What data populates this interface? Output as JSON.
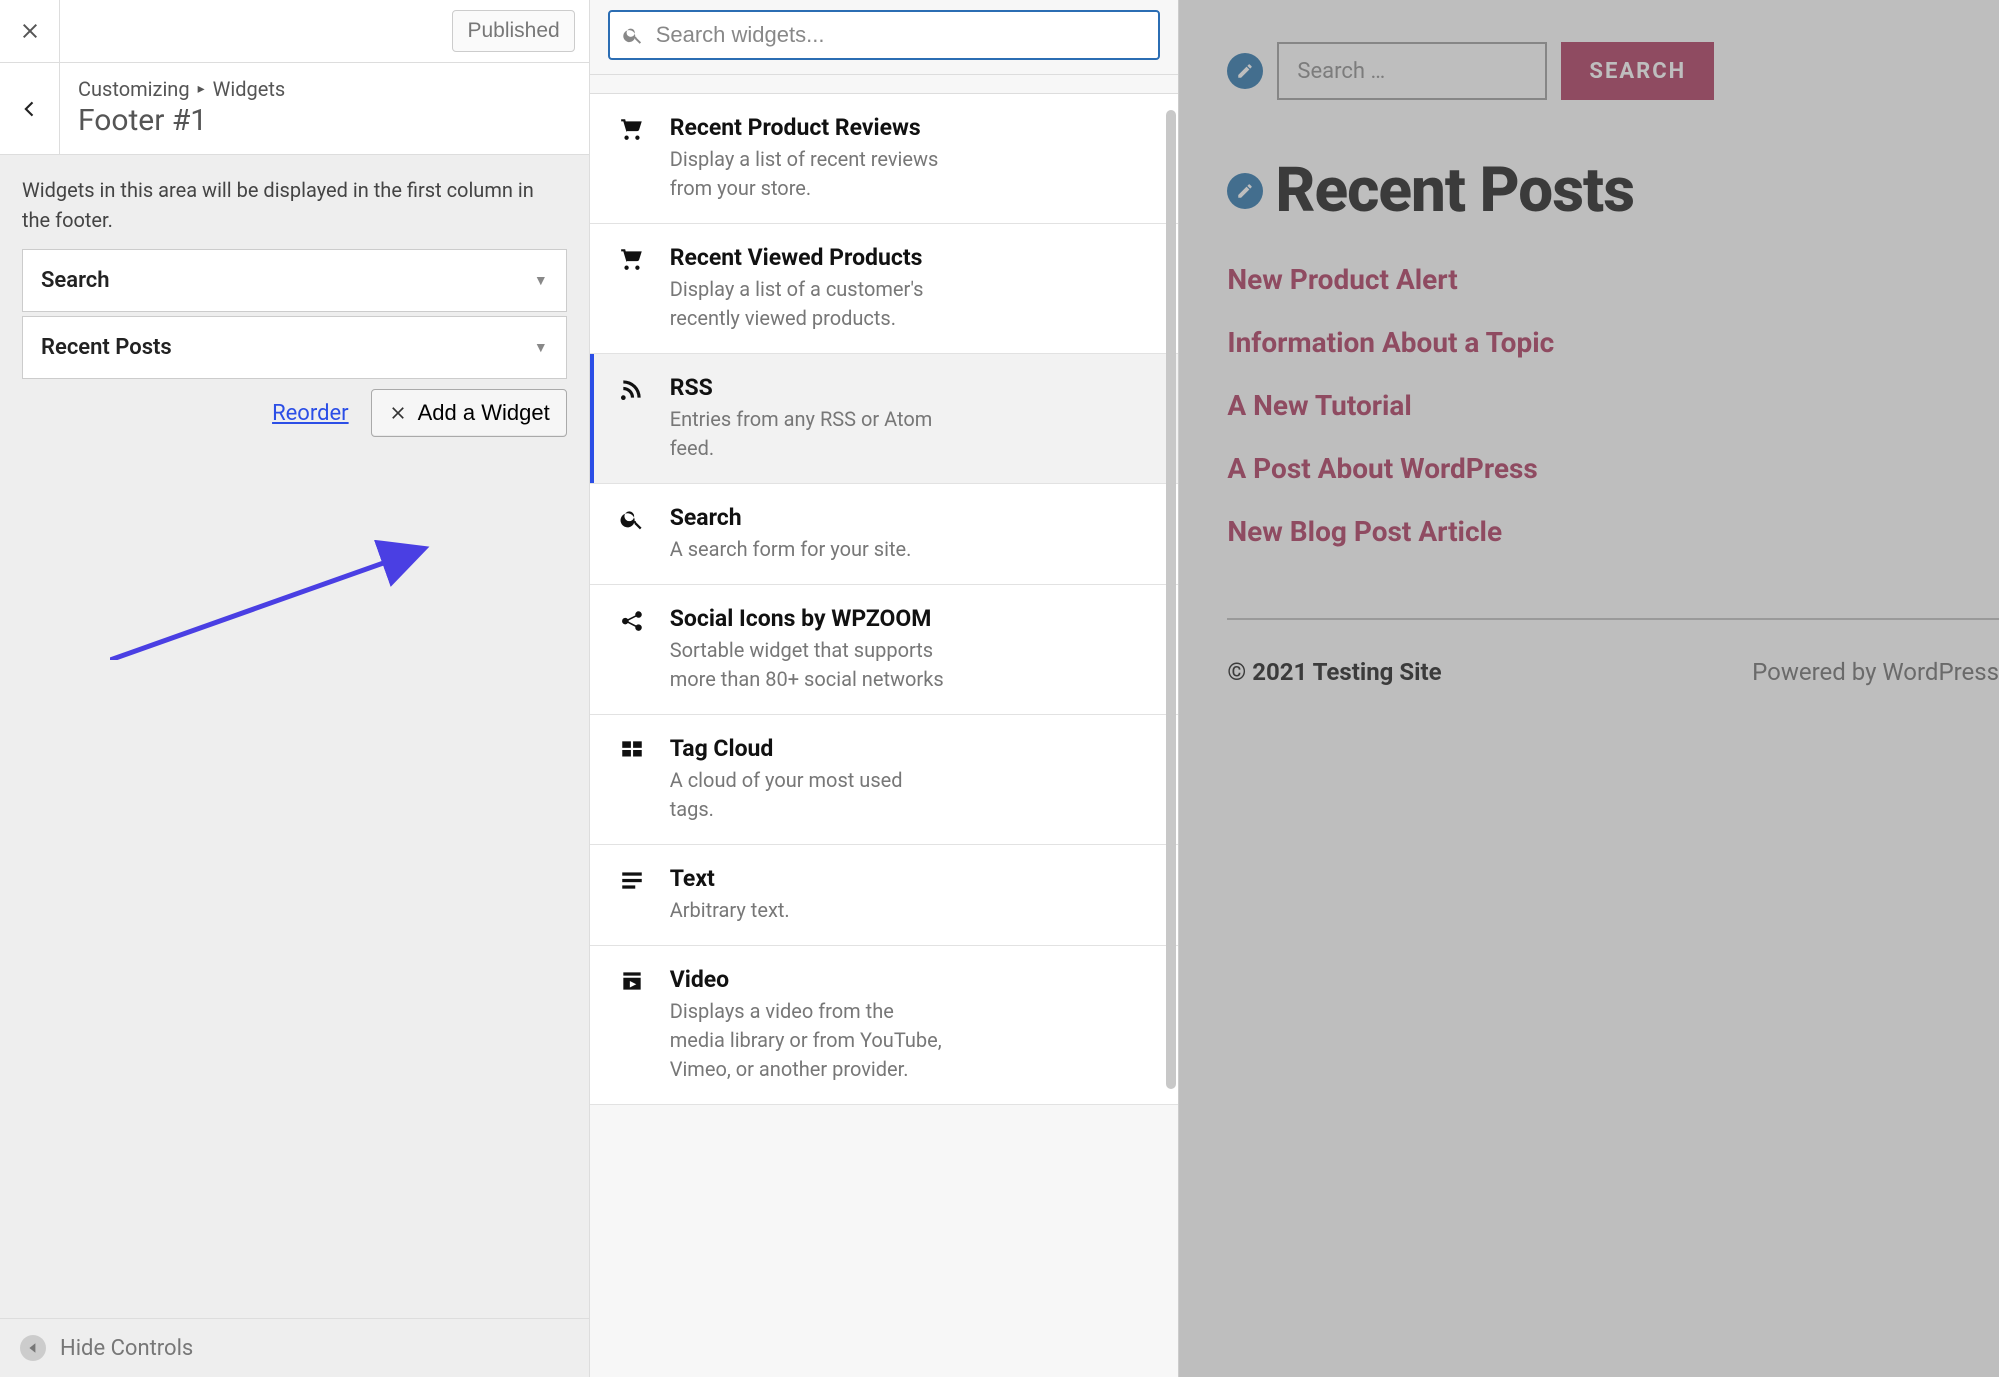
{
  "topbar": {
    "publish_label": "Published"
  },
  "breadcrumb": {
    "customizing": "Customizing",
    "widgets": "Widgets"
  },
  "section_title": "Footer #1",
  "area_description": "Widgets in this area will be displayed in the first column in the footer.",
  "current_widgets": [
    {
      "label": "Search"
    },
    {
      "label": "Recent Posts"
    }
  ],
  "reorder_label": "Reorder",
  "add_widget_label": "Add a Widget",
  "hide_controls_label": "Hide Controls",
  "search_placeholder": "Search widgets...",
  "available_widgets": [
    {
      "icon": "cart",
      "title": "Recent Product Reviews",
      "desc": "Display a list of recent reviews from your store.",
      "hl": false
    },
    {
      "icon": "cart",
      "title": "Recent Viewed Products",
      "desc": "Display a list of a customer's recently viewed products.",
      "hl": false
    },
    {
      "icon": "rss",
      "title": "RSS",
      "desc": "Entries from any RSS or Atom feed.",
      "hl": true
    },
    {
      "icon": "search",
      "title": "Search",
      "desc": "A search form for your site.",
      "hl": false
    },
    {
      "icon": "share",
      "title": "Social Icons by WPZOOM",
      "desc": "Sortable widget that supports more than 80+ social networks",
      "hl": false
    },
    {
      "icon": "grid",
      "title": "Tag Cloud",
      "desc": "A cloud of your most used tags.",
      "hl": false
    },
    {
      "icon": "lines",
      "title": "Text",
      "desc": "Arbitrary text.",
      "hl": false
    },
    {
      "icon": "video",
      "title": "Video",
      "desc": "Displays a video from the media library or from YouTube, Vimeo, or another provider.",
      "hl": false
    }
  ],
  "preview": {
    "search_placeholder": "Search …",
    "search_button": "SEARCH",
    "recent_posts_heading": "Recent Posts",
    "posts": [
      "New Product Alert",
      "Information About a Topic",
      "A New Tutorial",
      "A Post About WordPress",
      "New Blog Post Article"
    ],
    "copyright": "© 2021 Testing Site",
    "powered": "Powered by WordPress"
  },
  "icons": {
    "close": "close-icon",
    "back": "chevron-left-icon",
    "dropdown": "chevron-down-icon",
    "plus": "plus-icon",
    "collapse": "triangle-left-icon",
    "magnifier": "search-icon",
    "pencil": "pencil-icon"
  }
}
